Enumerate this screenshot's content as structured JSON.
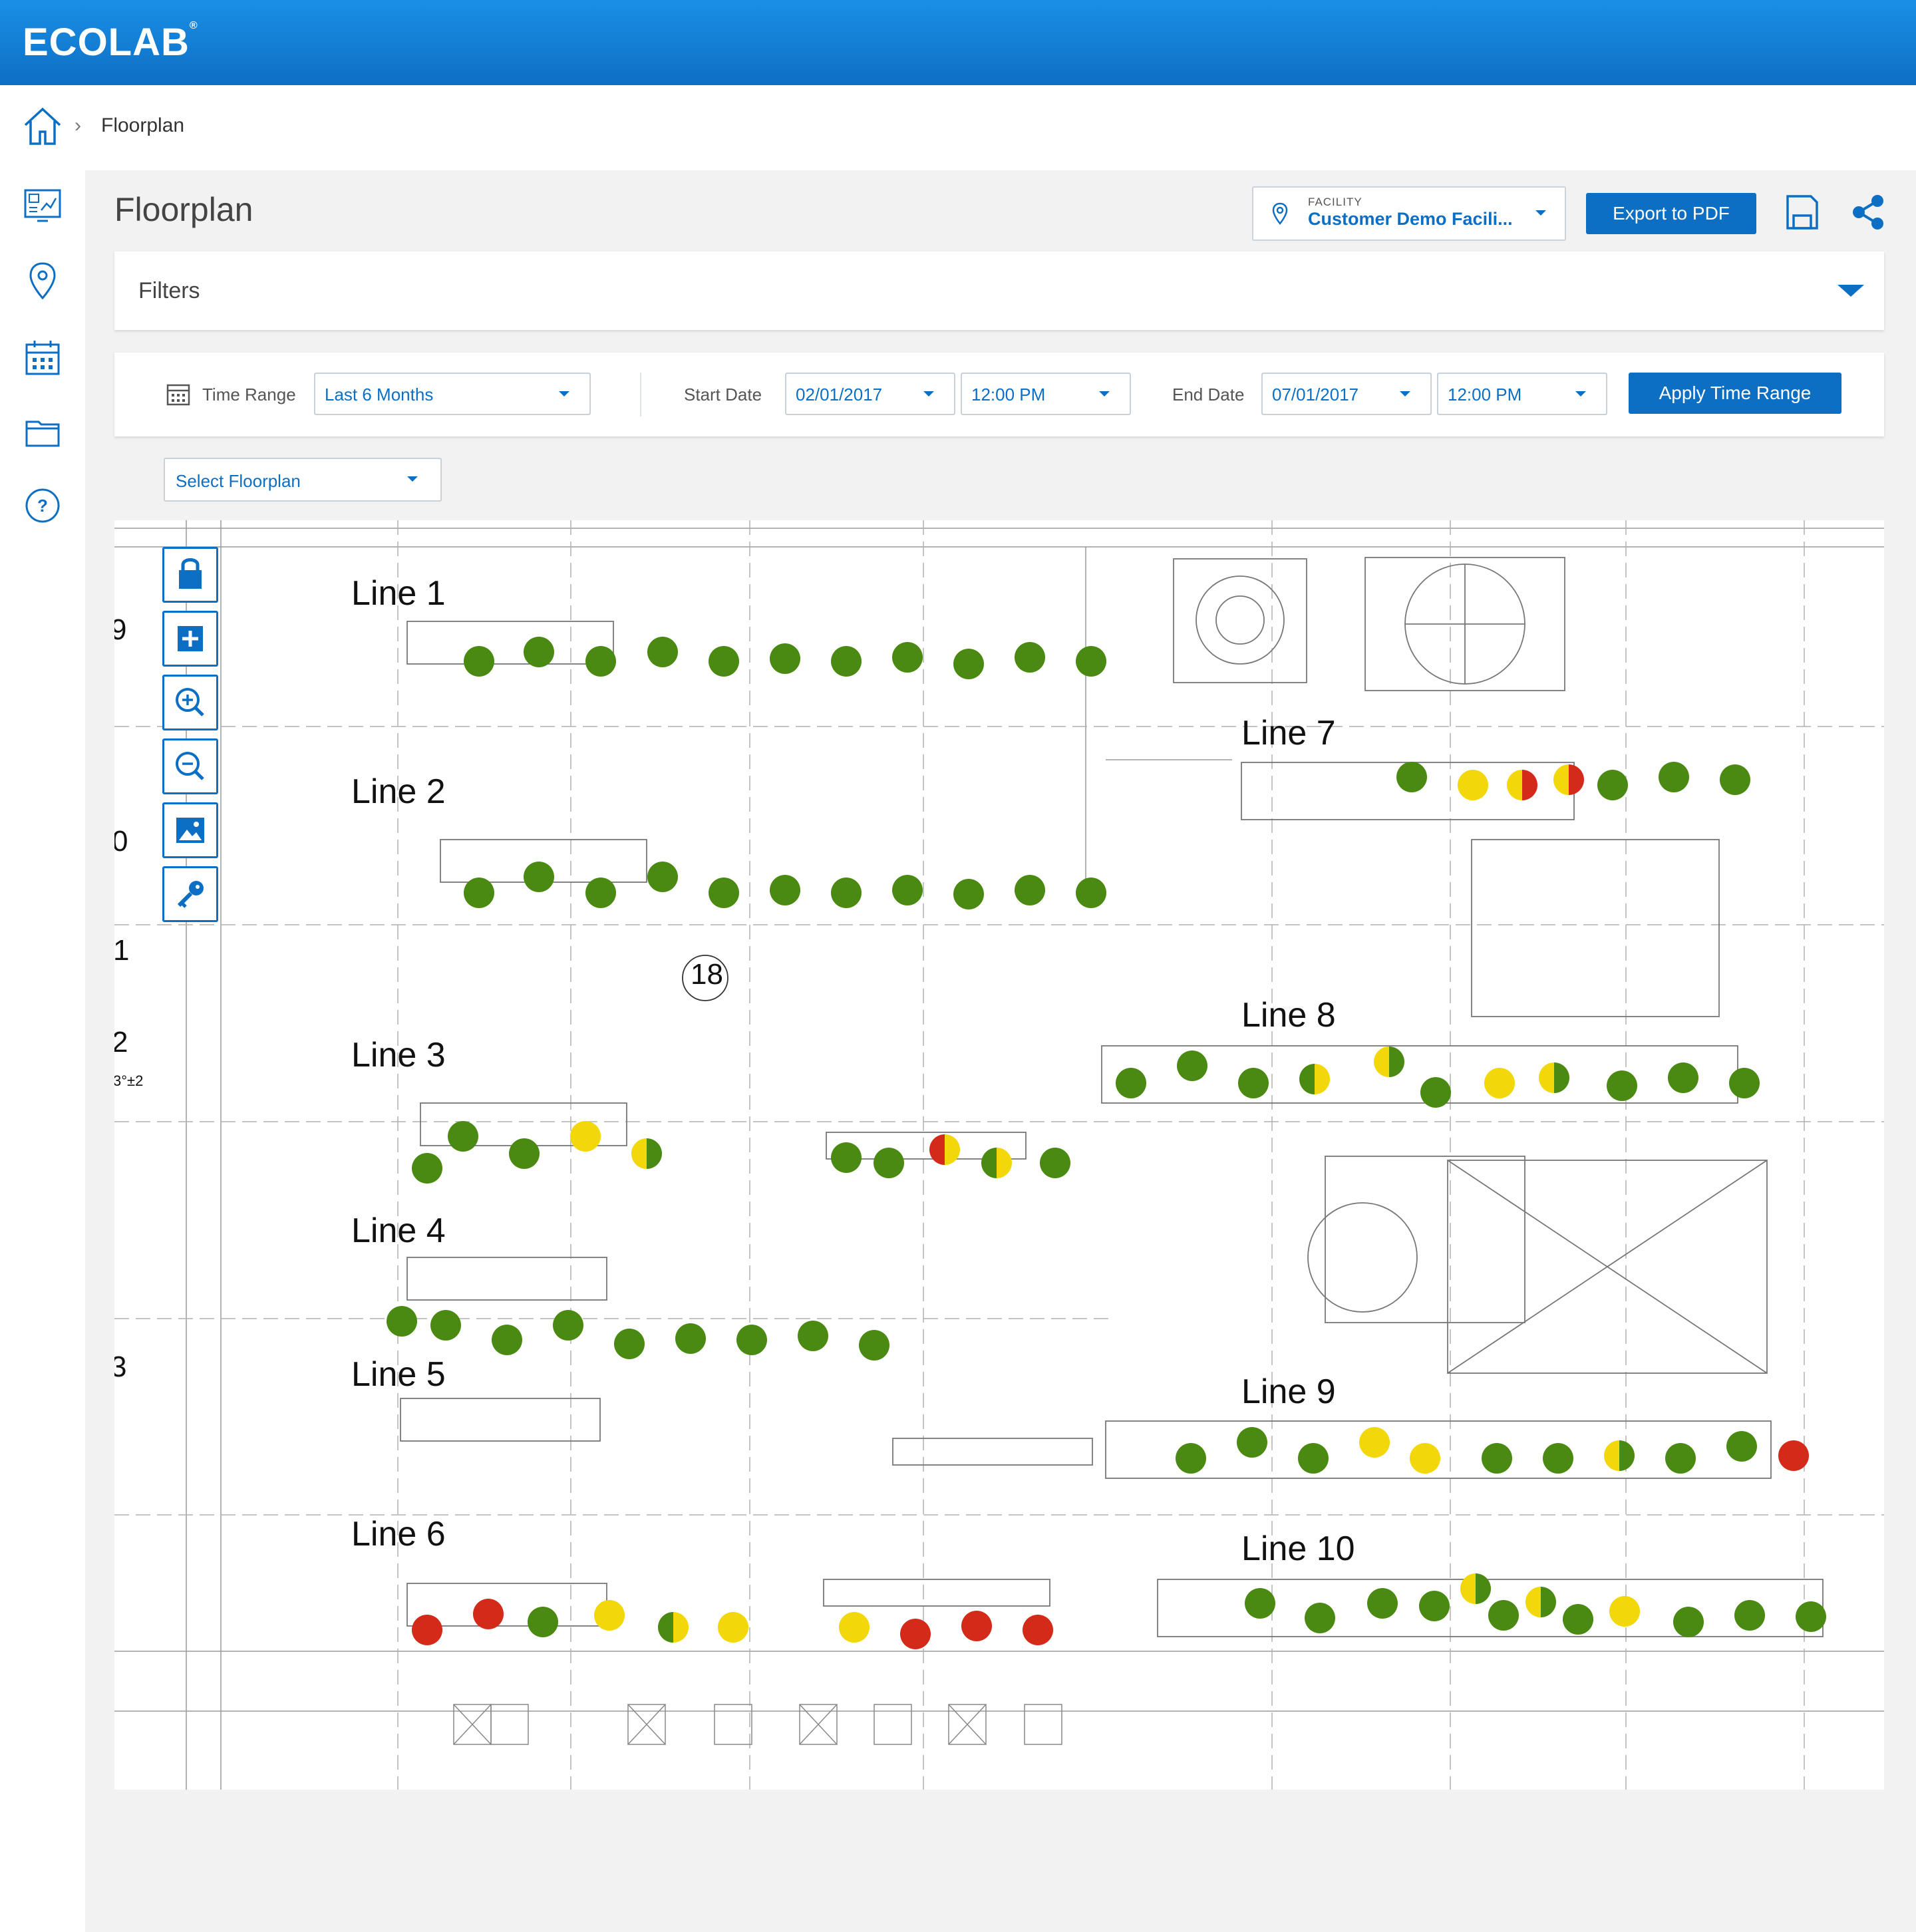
{
  "header": {
    "brand": "ECOLAB",
    "brand_mark": "®"
  },
  "breadcrumb": {
    "separator": "›",
    "current": "Floorplan"
  },
  "facility": {
    "label": "FACILITY",
    "value": "Customer Demo Facili..."
  },
  "actions": {
    "export_label": "Export to PDF"
  },
  "page": {
    "title": "Floorplan"
  },
  "filters": {
    "label": "Filters"
  },
  "timebar": {
    "time_range_label": "Time Range",
    "time_range_value": "Last 6 Months",
    "start_label": "Start Date",
    "start_date": "02/01/2017",
    "start_time": "12:00 PM",
    "end_label": "End Date",
    "end_date": "07/01/2017",
    "end_time": "12:00 PM",
    "apply_label": "Apply Time Range"
  },
  "floorplan_select": {
    "placeholder": "Select Floorplan"
  },
  "map": {
    "lines": [
      "Line 1",
      "Line 2",
      "Line 3",
      "Line 4",
      "Line 5",
      "Line 6",
      "Line 7",
      "Line 8",
      "Line 9",
      "Line 10"
    ],
    "room_number": "18",
    "edge_labels": [
      "9",
      "0",
      "1",
      "2",
      "3"
    ],
    "edge_note": "3°±2",
    "status_colors": {
      "ok": "#4a8a12",
      "warning": "#f2d80a",
      "alarm": "#d42a1a"
    }
  },
  "icons": {
    "home": "home-icon",
    "pin": "location-pin-icon",
    "dashboard": "dashboard-icon",
    "calendar": "calendar-icon",
    "folder": "folder-icon",
    "help": "help-icon",
    "save": "save-icon",
    "share": "share-icon",
    "lock": "lock-icon",
    "plus": "plus-icon",
    "zoom_in": "zoom-in-icon",
    "zoom_out": "zoom-out-icon",
    "image": "image-icon",
    "key": "key-icon"
  }
}
